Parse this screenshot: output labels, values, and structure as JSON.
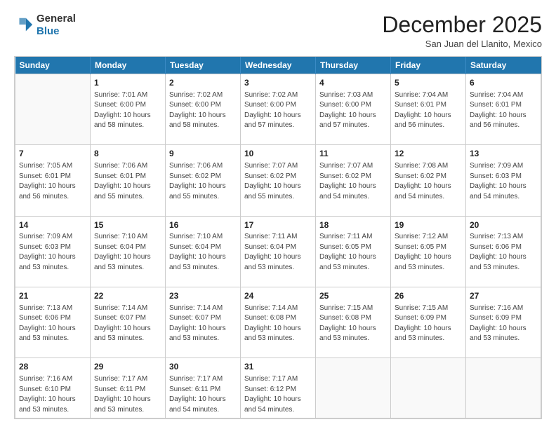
{
  "header": {
    "logo_line1": "General",
    "logo_line2": "Blue",
    "month": "December 2025",
    "location": "San Juan del Llanito, Mexico"
  },
  "weekdays": [
    "Sunday",
    "Monday",
    "Tuesday",
    "Wednesday",
    "Thursday",
    "Friday",
    "Saturday"
  ],
  "weeks": [
    [
      {
        "day": "",
        "info": ""
      },
      {
        "day": "1",
        "info": "Sunrise: 7:01 AM\nSunset: 6:00 PM\nDaylight: 10 hours\nand 58 minutes."
      },
      {
        "day": "2",
        "info": "Sunrise: 7:02 AM\nSunset: 6:00 PM\nDaylight: 10 hours\nand 58 minutes."
      },
      {
        "day": "3",
        "info": "Sunrise: 7:02 AM\nSunset: 6:00 PM\nDaylight: 10 hours\nand 57 minutes."
      },
      {
        "day": "4",
        "info": "Sunrise: 7:03 AM\nSunset: 6:00 PM\nDaylight: 10 hours\nand 57 minutes."
      },
      {
        "day": "5",
        "info": "Sunrise: 7:04 AM\nSunset: 6:01 PM\nDaylight: 10 hours\nand 56 minutes."
      },
      {
        "day": "6",
        "info": "Sunrise: 7:04 AM\nSunset: 6:01 PM\nDaylight: 10 hours\nand 56 minutes."
      }
    ],
    [
      {
        "day": "7",
        "info": "Sunrise: 7:05 AM\nSunset: 6:01 PM\nDaylight: 10 hours\nand 56 minutes."
      },
      {
        "day": "8",
        "info": "Sunrise: 7:06 AM\nSunset: 6:01 PM\nDaylight: 10 hours\nand 55 minutes."
      },
      {
        "day": "9",
        "info": "Sunrise: 7:06 AM\nSunset: 6:02 PM\nDaylight: 10 hours\nand 55 minutes."
      },
      {
        "day": "10",
        "info": "Sunrise: 7:07 AM\nSunset: 6:02 PM\nDaylight: 10 hours\nand 55 minutes."
      },
      {
        "day": "11",
        "info": "Sunrise: 7:07 AM\nSunset: 6:02 PM\nDaylight: 10 hours\nand 54 minutes."
      },
      {
        "day": "12",
        "info": "Sunrise: 7:08 AM\nSunset: 6:02 PM\nDaylight: 10 hours\nand 54 minutes."
      },
      {
        "day": "13",
        "info": "Sunrise: 7:09 AM\nSunset: 6:03 PM\nDaylight: 10 hours\nand 54 minutes."
      }
    ],
    [
      {
        "day": "14",
        "info": "Sunrise: 7:09 AM\nSunset: 6:03 PM\nDaylight: 10 hours\nand 53 minutes."
      },
      {
        "day": "15",
        "info": "Sunrise: 7:10 AM\nSunset: 6:04 PM\nDaylight: 10 hours\nand 53 minutes."
      },
      {
        "day": "16",
        "info": "Sunrise: 7:10 AM\nSunset: 6:04 PM\nDaylight: 10 hours\nand 53 minutes."
      },
      {
        "day": "17",
        "info": "Sunrise: 7:11 AM\nSunset: 6:04 PM\nDaylight: 10 hours\nand 53 minutes."
      },
      {
        "day": "18",
        "info": "Sunrise: 7:11 AM\nSunset: 6:05 PM\nDaylight: 10 hours\nand 53 minutes."
      },
      {
        "day": "19",
        "info": "Sunrise: 7:12 AM\nSunset: 6:05 PM\nDaylight: 10 hours\nand 53 minutes."
      },
      {
        "day": "20",
        "info": "Sunrise: 7:13 AM\nSunset: 6:06 PM\nDaylight: 10 hours\nand 53 minutes."
      }
    ],
    [
      {
        "day": "21",
        "info": "Sunrise: 7:13 AM\nSunset: 6:06 PM\nDaylight: 10 hours\nand 53 minutes."
      },
      {
        "day": "22",
        "info": "Sunrise: 7:14 AM\nSunset: 6:07 PM\nDaylight: 10 hours\nand 53 minutes."
      },
      {
        "day": "23",
        "info": "Sunrise: 7:14 AM\nSunset: 6:07 PM\nDaylight: 10 hours\nand 53 minutes."
      },
      {
        "day": "24",
        "info": "Sunrise: 7:14 AM\nSunset: 6:08 PM\nDaylight: 10 hours\nand 53 minutes."
      },
      {
        "day": "25",
        "info": "Sunrise: 7:15 AM\nSunset: 6:08 PM\nDaylight: 10 hours\nand 53 minutes."
      },
      {
        "day": "26",
        "info": "Sunrise: 7:15 AM\nSunset: 6:09 PM\nDaylight: 10 hours\nand 53 minutes."
      },
      {
        "day": "27",
        "info": "Sunrise: 7:16 AM\nSunset: 6:09 PM\nDaylight: 10 hours\nand 53 minutes."
      }
    ],
    [
      {
        "day": "28",
        "info": "Sunrise: 7:16 AM\nSunset: 6:10 PM\nDaylight: 10 hours\nand 53 minutes."
      },
      {
        "day": "29",
        "info": "Sunrise: 7:17 AM\nSunset: 6:11 PM\nDaylight: 10 hours\nand 53 minutes."
      },
      {
        "day": "30",
        "info": "Sunrise: 7:17 AM\nSunset: 6:11 PM\nDaylight: 10 hours\nand 54 minutes."
      },
      {
        "day": "31",
        "info": "Sunrise: 7:17 AM\nSunset: 6:12 PM\nDaylight: 10 hours\nand 54 minutes."
      },
      {
        "day": "",
        "info": ""
      },
      {
        "day": "",
        "info": ""
      },
      {
        "day": "",
        "info": ""
      }
    ]
  ]
}
